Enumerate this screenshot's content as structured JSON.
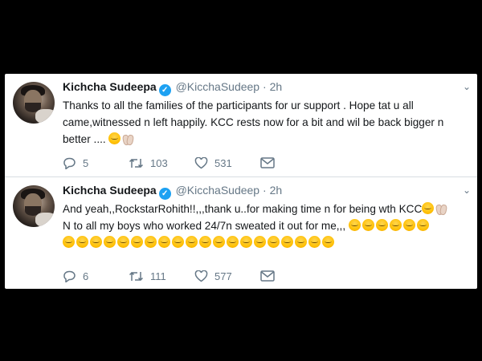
{
  "tweets": [
    {
      "name": "Kichcha Sudeepa",
      "handle": "@KicchaSudeep",
      "separator": "·",
      "time": "2h",
      "text": "Thanks to all the families of the participants for ur support . Hope tat u all came,witnessed n left happily. KCC rests now for a bit and wil be back bigger n better ....",
      "emoji_after": [
        "hugging-face",
        "clapping-hands"
      ],
      "replies": "5",
      "retweets": "103",
      "likes": "531"
    },
    {
      "name": "Kichcha Sudeepa",
      "handle": "@KicchaSudeep",
      "separator": "·",
      "time": "2h",
      "text_line1": "And yeah,,RockstarRohith!!,,,thank u..for making time n for being wth KCC",
      "text_line2": "N to all my boys who worked 24/7n sweated it out for me,,,",
      "emoji_line1": [
        "hugging-face",
        "folded-hands"
      ],
      "emoji_line2_count": 6,
      "emoji_line3_count": 20,
      "replies": "6",
      "retweets": "111",
      "likes": "577"
    }
  ],
  "icons": {
    "reply": "reply-icon",
    "retweet": "retweet-icon",
    "like": "heart-icon",
    "dm": "envelope-icon",
    "verified": "verified-badge-icon",
    "more": "chevron-down-icon"
  },
  "colors": {
    "background": "#000000",
    "card": "#ffffff",
    "text": "#14171a",
    "muted": "#657786",
    "verified": "#1da1f2"
  }
}
